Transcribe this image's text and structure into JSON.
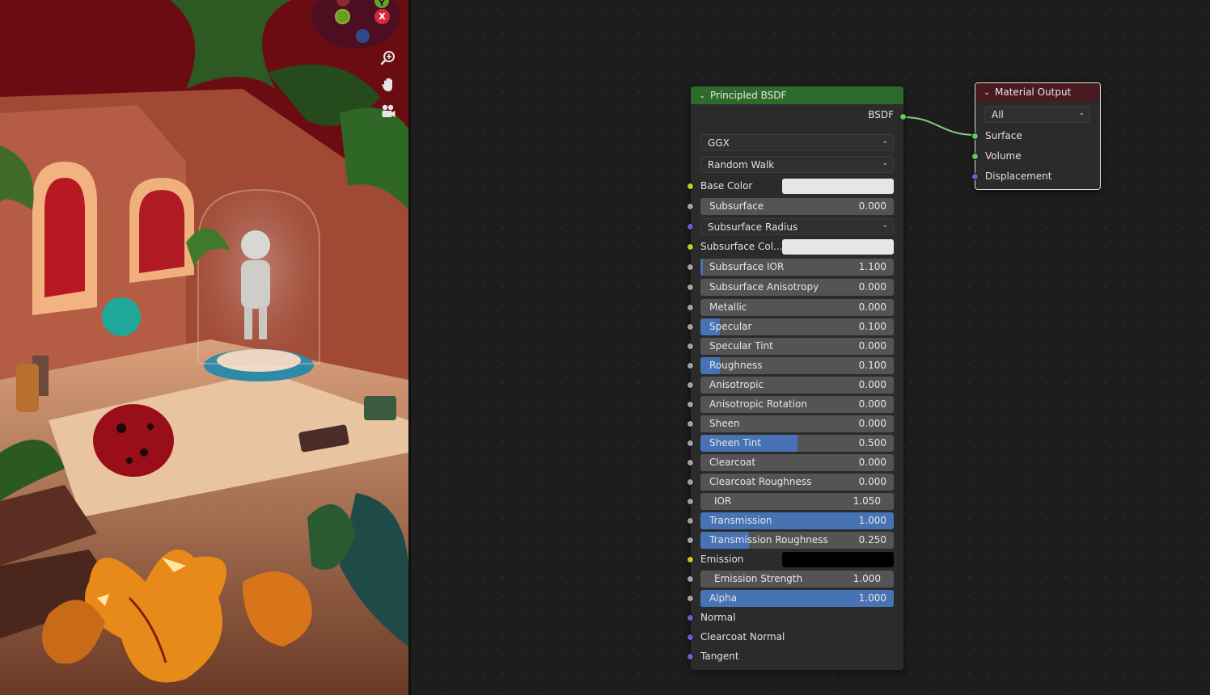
{
  "viewport": {
    "gizmo": {
      "x_axis_label": "X",
      "y_axis_label": "Y"
    },
    "tools": [
      "zoom-icon",
      "pan-hand-icon",
      "camera-icon"
    ]
  },
  "principled_bsdf": {
    "title": "Principled BSDF",
    "output_label": "BSDF",
    "distribution": "GGX",
    "subsurface_method": "Random Walk",
    "inputs": [
      {
        "label": "Base Color",
        "kind": "color",
        "color": "#e6e6e6",
        "socket": "yellow"
      },
      {
        "label": "Subsurface",
        "kind": "slider",
        "value": "0.000",
        "fraction": 0.0,
        "socket": "gray"
      },
      {
        "label": "Subsurface Radius",
        "kind": "dropdown",
        "socket": "blue"
      },
      {
        "label": "Subsurface Col...",
        "kind": "color",
        "color": "#e6e6e6",
        "socket": "yellow"
      },
      {
        "label": "Subsurface IOR",
        "kind": "slider",
        "value": "1.100",
        "fraction": 0.012,
        "socket": "gray"
      },
      {
        "label": "Subsurface Anisotropy",
        "kind": "slider",
        "value": "0.000",
        "fraction": 0.0,
        "socket": "gray"
      },
      {
        "label": "Metallic",
        "kind": "slider",
        "value": "0.000",
        "fraction": 0.0,
        "socket": "gray"
      },
      {
        "label": "Specular",
        "kind": "slider",
        "value": "0.100",
        "fraction": 0.1,
        "socket": "gray"
      },
      {
        "label": "Specular Tint",
        "kind": "slider",
        "value": "0.000",
        "fraction": 0.0,
        "socket": "gray"
      },
      {
        "label": "Roughness",
        "kind": "slider",
        "value": "0.100",
        "fraction": 0.1,
        "socket": "gray"
      },
      {
        "label": "Anisotropic",
        "kind": "slider",
        "value": "0.000",
        "fraction": 0.0,
        "socket": "gray"
      },
      {
        "label": "Anisotropic Rotation",
        "kind": "slider",
        "value": "0.000",
        "fraction": 0.0,
        "socket": "gray"
      },
      {
        "label": "Sheen",
        "kind": "slider",
        "value": "0.000",
        "fraction": 0.0,
        "socket": "gray"
      },
      {
        "label": "Sheen Tint",
        "kind": "slider",
        "value": "0.500",
        "fraction": 0.5,
        "socket": "gray"
      },
      {
        "label": "Clearcoat",
        "kind": "slider",
        "value": "0.000",
        "fraction": 0.0,
        "socket": "gray"
      },
      {
        "label": "Clearcoat Roughness",
        "kind": "slider",
        "value": "0.000",
        "fraction": 0.0,
        "socket": "gray"
      },
      {
        "label": "IOR",
        "kind": "slider-inset",
        "value": "1.050",
        "fraction": 0.0,
        "socket": "gray"
      },
      {
        "label": "Transmission",
        "kind": "slider",
        "value": "1.000",
        "fraction": 1.0,
        "socket": "gray"
      },
      {
        "label": "Transmission Roughness",
        "kind": "slider",
        "value": "0.250",
        "fraction": 0.25,
        "socket": "gray"
      },
      {
        "label": "Emission",
        "kind": "color",
        "color": "#000000",
        "socket": "yellow"
      },
      {
        "label": "Emission Strength",
        "kind": "slider-inset",
        "value": "1.000",
        "fraction": 0.0,
        "socket": "gray"
      },
      {
        "label": "Alpha",
        "kind": "slider",
        "value": "1.000",
        "fraction": 1.0,
        "socket": "gray"
      },
      {
        "label": "Normal",
        "kind": "socket-only",
        "socket": "blue"
      },
      {
        "label": "Clearcoat Normal",
        "kind": "socket-only",
        "socket": "blue"
      },
      {
        "label": "Tangent",
        "kind": "socket-only",
        "socket": "blue"
      }
    ]
  },
  "material_output": {
    "title": "Material Output",
    "target": "All",
    "inputs": [
      {
        "label": "Surface",
        "socket": "green"
      },
      {
        "label": "Volume",
        "socket": "green"
      },
      {
        "label": "Displacement",
        "socket": "blue"
      }
    ]
  },
  "colors": {
    "accent_blue": "#4772b3",
    "bsdf_header": "#2e6a2c",
    "output_header": "#4a1a20",
    "link_green": "#63c763"
  }
}
